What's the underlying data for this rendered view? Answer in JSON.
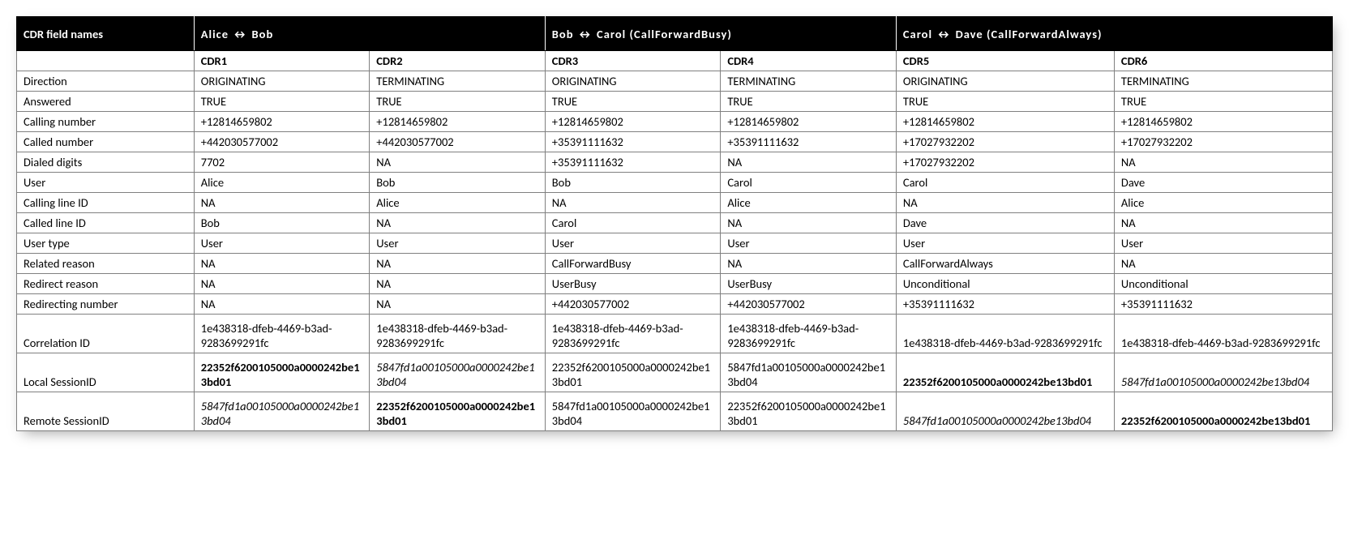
{
  "header": {
    "field_names": "CDR field names",
    "group_a": "Alice ↔ Bob",
    "group_b": "Bob ↔ Carol (CallForwardBusy)",
    "group_c": "Carol ↔ Dave (CallForwardAlways)"
  },
  "subheader": [
    "CDR1",
    "CDR2",
    "CDR3",
    "CDR4",
    "CDR5",
    "CDR6"
  ],
  "row_labels": [
    "Direction",
    "Answered",
    "Calling number",
    "Called number",
    "Dialed digits",
    "User",
    "Calling line ID",
    "Called line ID",
    "User type",
    "Related reason",
    "Redirect reason",
    "Redirecting number",
    "Correlation ID",
    "Local SessionID",
    "Remote SessionID"
  ],
  "rows": {
    "direction": [
      "ORIGINATING",
      "TERMINATING",
      "ORIGINATING",
      "TERMINATING",
      "ORIGINATING",
      "TERMINATING"
    ],
    "answered": [
      "TRUE",
      "TRUE",
      "TRUE",
      "TRUE",
      "TRUE",
      "TRUE"
    ],
    "calling_number": [
      "+12814659802",
      "+12814659802",
      "+12814659802",
      "+12814659802",
      "+12814659802",
      "+12814659802"
    ],
    "called_number": [
      "+442030577002",
      "+442030577002",
      "+35391111632",
      "+35391111632",
      "+17027932202",
      "+17027932202"
    ],
    "dialed_digits": [
      "7702",
      "NA",
      "+35391111632",
      "NA",
      "+17027932202",
      "NA"
    ],
    "user": [
      "Alice",
      "Bob",
      "Bob",
      "Carol",
      "Carol",
      "Dave"
    ],
    "calling_line_id": [
      "NA",
      "Alice",
      "NA",
      "Alice",
      "NA",
      "Alice"
    ],
    "called_line_id": [
      "Bob",
      "NA",
      "Carol",
      "NA",
      "Dave",
      "NA"
    ],
    "user_type": [
      "User",
      "User",
      "User",
      "User",
      "User",
      "User"
    ],
    "related_reason": [
      "NA",
      "NA",
      "CallForwardBusy",
      "NA",
      "CallForwardAlways",
      "NA"
    ],
    "redirect_reason": [
      "NA",
      "NA",
      "UserBusy",
      "UserBusy",
      "Unconditional",
      "Unconditional"
    ],
    "redirecting_num": [
      "NA",
      "NA",
      "+442030577002",
      "+442030577002",
      "+35391111632",
      "+35391111632"
    ],
    "correlation_id": [
      "1e438318-dfeb-4469-b3ad-9283699291fc",
      "1e438318-dfeb-4469-b3ad-9283699291fc",
      "1e438318-dfeb-4469-b3ad-9283699291fc",
      "1e438318-dfeb-4469-b3ad-9283699291fc",
      "1e438318-dfeb-4469-b3ad-9283699291fc",
      "1e438318-dfeb-4469-b3ad-9283699291fc"
    ],
    "local_session_id": [
      "22352f6200105000a0000242be13bd01",
      "5847fd1a00105000a0000242be13bd04",
      "22352f6200105000a0000242be13bd01",
      "5847fd1a00105000a0000242be13bd04",
      "22352f6200105000a0000242be13bd01",
      "5847fd1a00105000a0000242be13bd04"
    ],
    "remote_session_id": [
      "5847fd1a00105000a0000242be13bd04",
      "22352f6200105000a0000242be13bd01",
      "5847fd1a00105000a0000242be13bd04",
      "22352f6200105000a0000242be13bd01",
      "5847fd1a00105000a0000242be13bd04",
      "22352f6200105000a0000242be13bd01"
    ]
  },
  "styles": {
    "local_session_id": [
      "b",
      "i",
      "",
      "",
      "b",
      "i"
    ],
    "remote_session_id": [
      "i",
      "b",
      "",
      "",
      "i",
      "b"
    ]
  }
}
